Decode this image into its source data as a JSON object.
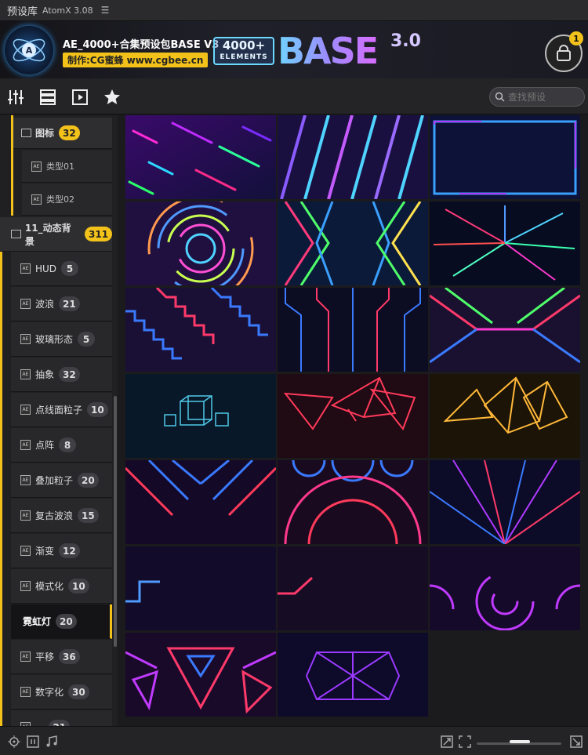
{
  "window": {
    "title": "预设库",
    "version": "AtomX 3.08",
    "menu_icon": "hamburger-icon"
  },
  "banner": {
    "title": "AE_4000+合集预设包BASE V3",
    "subtitle": "制作:CG蜜蜂 www.cgbee.cn",
    "brand_top": "4000+",
    "brand_small": "ELEMENTS",
    "brand_word": "BASE",
    "brand_version": "3.0",
    "cart_count": "1"
  },
  "toolbar": {
    "icons": [
      "sliders-icon",
      "list-icon",
      "play-file-icon",
      "star-icon"
    ]
  },
  "search": {
    "placeholder": "查找预设"
  },
  "sidebar": {
    "items": [
      {
        "label": "图标",
        "count": "32",
        "kind": "folder",
        "highlight": true
      },
      {
        "label": "类型01",
        "kind": "preset"
      },
      {
        "label": "类型02",
        "kind": "preset"
      },
      {
        "label": "11_动态背景",
        "count": "311",
        "kind": "folder",
        "highlight": true
      },
      {
        "label": "HUD",
        "count": "5",
        "kind": "preset"
      },
      {
        "label": "波浪",
        "count": "21",
        "kind": "preset"
      },
      {
        "label": "玻璃形态",
        "count": "5",
        "kind": "preset"
      },
      {
        "label": "抽象",
        "count": "32",
        "kind": "preset"
      },
      {
        "label": "点线面粒子",
        "count": "10",
        "kind": "preset"
      },
      {
        "label": "点阵",
        "count": "8",
        "kind": "preset"
      },
      {
        "label": "叠加粒子",
        "count": "20",
        "kind": "preset"
      },
      {
        "label": "复古波浪",
        "count": "15",
        "kind": "preset"
      },
      {
        "label": "渐变",
        "count": "12",
        "kind": "preset"
      },
      {
        "label": "模式化",
        "count": "10",
        "kind": "preset"
      },
      {
        "label": "霓虹灯",
        "count": "20",
        "kind": "preset",
        "selected": true
      },
      {
        "label": "平移",
        "count": "36",
        "kind": "preset"
      },
      {
        "label": "数字化",
        "count": "30",
        "kind": "preset"
      },
      {
        "label": "...",
        "count": "21",
        "kind": "preset"
      }
    ]
  },
  "bottombar": {
    "icons": [
      "target-icon",
      "pause-icon",
      "music-icon",
      "fit-icon",
      "expand-icon"
    ],
    "zoom_level": 0.45
  },
  "colors": {
    "accent": "#f2c21b",
    "bg": "#1b1b1d",
    "panel": "#242427"
  }
}
